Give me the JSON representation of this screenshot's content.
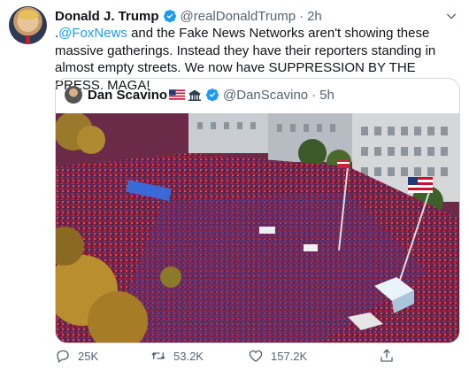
{
  "tweet": {
    "author_name": "Donald J. Trump",
    "handle": "@realDonaldTrump",
    "separator": "·",
    "time": "2h",
    "text_prefix": ".",
    "mention": "@FoxNews",
    "text_body": " and the Fake News Networks aren't showing these massive gatherings. Instead they have their reporters standing in almost empty streets. We now have SUPPRESSION BY THE PRESS. MAGA!",
    "avatar_icon": "user-avatar",
    "verified_icon": "verified-badge-icon",
    "more_icon": "chevron-down-icon"
  },
  "quoted_tweet": {
    "author_name": "Dan Scavino",
    "handle": "@DanScavino",
    "separator": "·",
    "time": "5h",
    "name_emoji": [
      "us-flag-icon",
      "white-house-icon"
    ],
    "photo": "aerial-crowd-rally-photo"
  },
  "actions": {
    "reply_count": "25K",
    "retweet_count": "53.2K",
    "like_count": "157.2K"
  },
  "colors": {
    "accent": "#1d9bf0",
    "secondary_text": "#536471",
    "border": "#cfd9de"
  }
}
